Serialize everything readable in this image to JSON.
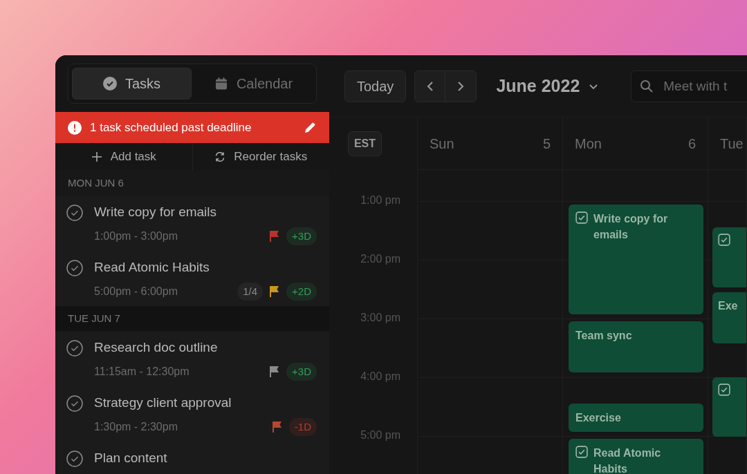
{
  "sidebar": {
    "tabs": [
      {
        "label": "Tasks",
        "selected": true
      },
      {
        "label": "Calendar",
        "selected": false
      }
    ],
    "alert": {
      "text": "1 task scheduled past deadline"
    },
    "actions": [
      {
        "label": "Add task"
      },
      {
        "label": "Reorder tasks"
      }
    ],
    "groups": [
      {
        "heading": "MON JUN 6",
        "tasks": [
          {
            "title": "Write copy for emails",
            "time": "1:00pm - 3:00pm",
            "flag": {
              "color": "#b8352b"
            },
            "delta": {
              "text": "+3D",
              "color": "#2f9e5a"
            }
          },
          {
            "title": "Read Atomic Habits",
            "time": "5:00pm - 6:00pm",
            "subtasks": "1/4",
            "flag": {
              "color": "#c9971c"
            },
            "delta": {
              "text": "+2D",
              "color": "#2f9e5a"
            }
          }
        ]
      },
      {
        "heading": "TUE JUN 7",
        "tasks": [
          {
            "title": "Research doc outline",
            "time": "11:15am - 12:30pm",
            "flag": {
              "color": "#8a8a8a"
            },
            "delta": {
              "text": "+3D",
              "color": "#2f9e5a"
            }
          },
          {
            "title": "Strategy client approval",
            "time": "1:30pm - 2:30pm",
            "flag": {
              "color": "#b8452f"
            },
            "delta": {
              "text": "-1D",
              "color": "#b83a2e"
            }
          },
          {
            "title": "Plan content"
          }
        ]
      }
    ]
  },
  "toolbar": {
    "today": "Today",
    "month": "June 2022",
    "search": {
      "placeholder": "Meet with t"
    }
  },
  "calendar": {
    "timezone": "EST",
    "hours": [
      "1:00 pm",
      "2:00 pm",
      "3:00 pm",
      "4:00 pm",
      "5:00 pm"
    ],
    "days": [
      {
        "name": "Sun",
        "date": "5"
      },
      {
        "name": "Mon",
        "date": "6",
        "events": [
          {
            "kind": "task",
            "title": "Write copy for emails"
          },
          {
            "kind": "event",
            "title": "Team sync"
          },
          {
            "kind": "event",
            "title": "Exercise"
          },
          {
            "kind": "task",
            "title": "Read Atomic Habits"
          }
        ]
      },
      {
        "name": "Tue",
        "events": [
          {
            "kind": "task"
          },
          {
            "kind": "event",
            "title": "Exe"
          },
          {
            "kind": "task"
          }
        ]
      }
    ]
  }
}
